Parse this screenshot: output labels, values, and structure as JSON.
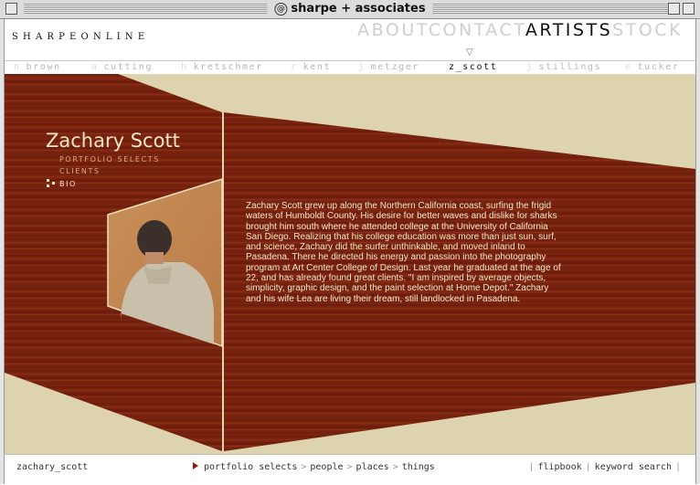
{
  "window": {
    "title": "sharpe + associates"
  },
  "header": {
    "logo": "SHARPEONLINE",
    "nav": [
      {
        "label": "ABOUT",
        "active": false
      },
      {
        "label": "CONTACT",
        "active": false
      },
      {
        "label": "ARTISTS",
        "active": true
      },
      {
        "label": "STOCK",
        "active": false
      }
    ],
    "marker": "▽"
  },
  "artists": [
    {
      "initial": "n",
      "label": "brown",
      "active": false
    },
    {
      "initial": "a",
      "label": "cutting",
      "active": false
    },
    {
      "initial": "h",
      "label": "kretschmer",
      "active": false
    },
    {
      "initial": "r",
      "label": "kent",
      "active": false
    },
    {
      "initial": "j",
      "label": "metzger",
      "active": false
    },
    {
      "initial": "",
      "label": "z_scott",
      "active": true
    },
    {
      "initial": "j",
      "label": "stillings",
      "active": false
    },
    {
      "initial": "e",
      "label": "tucker",
      "active": false
    }
  ],
  "profile": {
    "name": "Zachary Scott",
    "menu": [
      {
        "label": "PORTFOLIO SELECTS",
        "active": false
      },
      {
        "label": "CLIENTS",
        "active": false
      },
      {
        "label": "BIO",
        "active": true
      }
    ],
    "bio": "Zachary Scott grew up along the Northern California coast, surfing the frigid waters of Humboldt County. His desire for better waves and dislike for sharks brought him south where he attended college at the University of California San Diego. Realizing that his college education was more than just sun, surf, and science, Zachary did the surfer unthinkable, and moved inland to Pasadena. There he directed his energy and passion into the photography program at Art Center College of Design. Last year he graduated at the age of 22, and has already found great clients. \"I am inspired by average objects, simplicity, graphic design, and the paint selection at Home Depot.\" Zachary and his wife Lea are living their dream, still landlocked in Pasadena."
  },
  "footer": {
    "crumb": "zachary_scott",
    "categories": [
      "portfolio selects",
      "people",
      "places",
      "things"
    ],
    "category_separator": ">",
    "tools": [
      "flipbook",
      "keyword search"
    ],
    "tool_separator": "|"
  },
  "colors": {
    "background_beige": "#ddd3ae",
    "wood": "#7a2410",
    "text_cream": "#f4e6c6",
    "accent_red": "#8b1a12"
  }
}
